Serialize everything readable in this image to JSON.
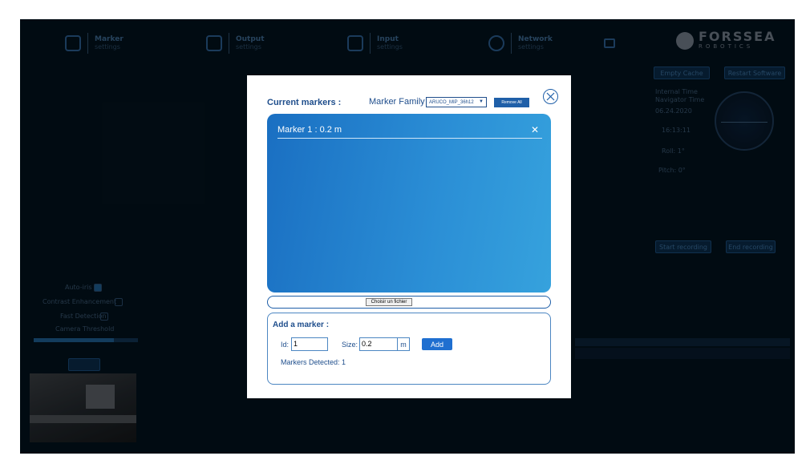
{
  "nav": {
    "items": [
      {
        "title": "Marker",
        "subtitle": "settings"
      },
      {
        "title": "Output",
        "subtitle": "settings"
      },
      {
        "title": "Input",
        "subtitle": "settings"
      },
      {
        "title": "Network",
        "subtitle": "settings"
      }
    ],
    "logo": {
      "name": "FORSSEA",
      "sub": "ROBOTICS"
    }
  },
  "right_panel": {
    "empty_cache": "Empty Cache",
    "restart_software": "Restart Software",
    "internal_time": "Internal Time",
    "navigator_time": "Navigator Time",
    "date": "06.24.2020",
    "time": "16:13:11",
    "roll": "Roll: 1°",
    "pitch": "Pitch: 0°",
    "start_recording": "Start recording",
    "end_recording": "End recording"
  },
  "left_panel": {
    "auto_iris": "Auto-iris",
    "contrast_enhancement": "Contrast Enhancement",
    "fast_detection": "Fast Detection",
    "camera_threshold": "Camera Threshold"
  },
  "modal": {
    "title": "Current markers :",
    "family_label": "Marker Family",
    "family_value": "ARUCO_MIP_36h12",
    "remove_all": "Remove All",
    "markers": [
      {
        "label": "Marker 1 :  0.2 m"
      }
    ],
    "delete_glyph": "✕",
    "file_button": "Choisir un fichier",
    "add_title": "Add a marker :",
    "id_label": "Id:",
    "id_value": "1",
    "size_label": "Size:",
    "size_value": "0.2",
    "unit": "m",
    "add_button": "Add",
    "detected": "Markers Detected: 1"
  },
  "colors": {
    "primary": "#1f4e8c",
    "button": "#1f6fd0",
    "panel_gradient_start": "#1a6fc2",
    "panel_gradient_end": "#36a2dd",
    "background": "#03121d"
  },
  "icons": {
    "close": "close-circle-icon",
    "select_arrow": "chevron-down-icon",
    "delete_marker": "close-icon"
  }
}
